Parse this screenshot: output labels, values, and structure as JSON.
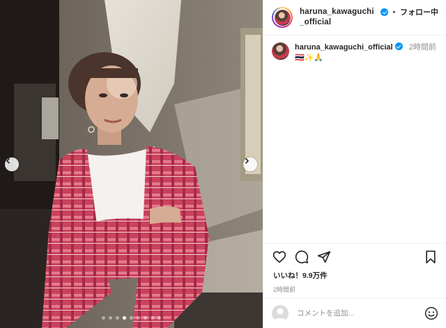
{
  "post": {
    "username": "haruna_kawaguchi_official",
    "follow_separator": "・",
    "follow_label": "フォロー中",
    "caption_time": "2時間前",
    "caption_text": "🇹🇭✨🙏",
    "likes_text": "いいね！9.9万件",
    "posted_time": "2時間前",
    "comment_placeholder": "コメントを追加...",
    "carousel": {
      "total": 9,
      "current_index": 3
    }
  },
  "colors": {
    "verified": "#0095f6",
    "text": "#262626",
    "muted": "#8e8e8e",
    "divider": "#efefef"
  },
  "icons": [
    "chevron-left-icon",
    "chevron-right-icon",
    "verified-badge-icon",
    "heart-icon",
    "comment-icon",
    "share-icon",
    "bookmark-icon",
    "user-silhouette-icon",
    "emoji-icon"
  ]
}
